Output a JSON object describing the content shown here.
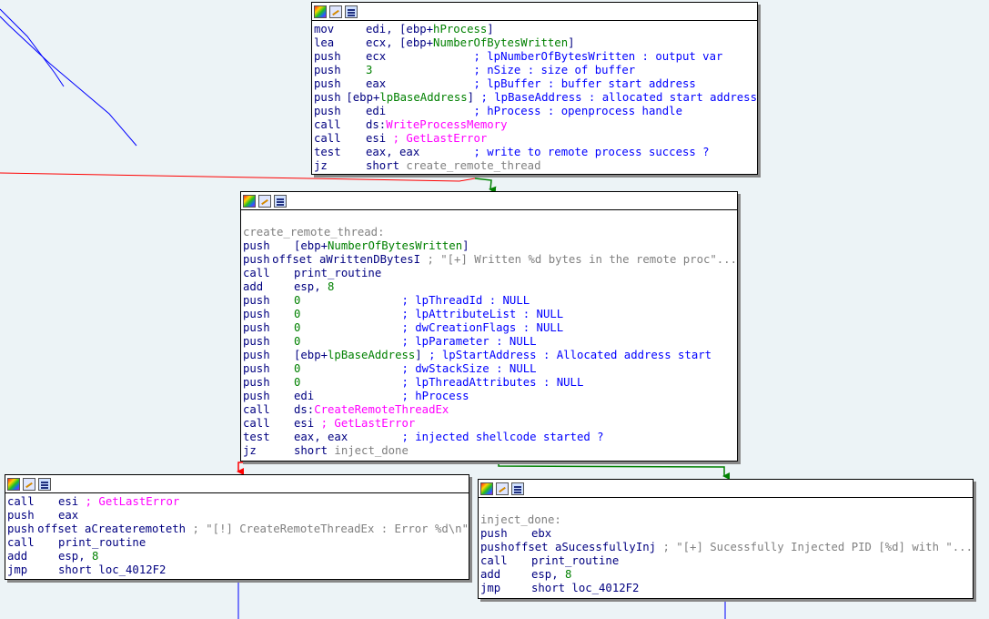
{
  "colors": {
    "background": "#ecf3f6",
    "false_branch_edge": "#ff0000",
    "true_branch_edge": "#008000",
    "normal_edge": "#0000ff",
    "mnemonic": "#000080",
    "immediate": "#008000",
    "import": "#ff00ff",
    "comment": "#0000ff",
    "string_comment": "#808080"
  },
  "icons": [
    "color-block-icon",
    "graph-overview-icon",
    "text-view-icon"
  ],
  "block1": {
    "lines": [
      {
        "m": "mov",
        "o": "edi, [ebp+",
        "v": "hProcess",
        "e": "]"
      },
      {
        "m": "lea",
        "o": "ecx, [ebp+",
        "v": "NumberOfBytesWritten",
        "e": "]"
      },
      {
        "m": "push",
        "o": "ecx             ",
        "c": "; lpNumberOfBytesWritten : output var"
      },
      {
        "m": "push",
        "n": "3",
        "o": "               ",
        "c": "; nSize : size of buffer"
      },
      {
        "m": "push",
        "o": "eax             ",
        "c": "; lpBuffer : buffer start address"
      },
      {
        "m": "push",
        "o": "[ebp+",
        "v": "lpBaseAddress",
        "e": "] ",
        "c": "; lpBaseAddress : allocated start address"
      },
      {
        "m": "push",
        "o": "edi             ",
        "c": "; hProcess : openprocess handle"
      },
      {
        "m": "call",
        "o": "ds:",
        "f": "WriteProcessMemory"
      },
      {
        "m": "call",
        "o": "esi ",
        "f": "; GetLastError"
      },
      {
        "m": "test",
        "o": "eax, eax        ",
        "c": "; write to remote process success ?"
      },
      {
        "m": "jz",
        "o": "short ",
        "l": "create_remote_thread"
      }
    ]
  },
  "block2": {
    "label": "create_remote_thread:",
    "lines": [
      {
        "m": "push",
        "o": "[ebp+",
        "v": "NumberOfBytesWritten",
        "e": "]"
      },
      {
        "m": "push",
        "o": "offset aWrittenDBytesI ",
        "s": "; \"[+] Written %d bytes in the remote proc\"..."
      },
      {
        "m": "call",
        "o": "print_routine"
      },
      {
        "m": "add",
        "o": "esp, ",
        "n": "8"
      },
      {
        "m": "push",
        "n": "0",
        "o": "               ",
        "c": "; lpThreadId : NULL"
      },
      {
        "m": "push",
        "n": "0",
        "o": "               ",
        "c": "; lpAttributeList : NULL"
      },
      {
        "m": "push",
        "n": "0",
        "o": "               ",
        "c": "; dwCreationFlags : NULL"
      },
      {
        "m": "push",
        "n": "0",
        "o": "               ",
        "c": "; lpParameter : NULL"
      },
      {
        "m": "push",
        "o": "[ebp+",
        "v": "lpBaseAddress",
        "e": "] ",
        "c": "; lpStartAddress : Allocated address start"
      },
      {
        "m": "push",
        "n": "0",
        "o": "               ",
        "c": "; dwStackSize : NULL"
      },
      {
        "m": "push",
        "n": "0",
        "o": "               ",
        "c": "; lpThreadAttributes : NULL"
      },
      {
        "m": "push",
        "o": "edi             ",
        "c": "; hProcess"
      },
      {
        "m": "call",
        "o": "ds:",
        "f": "CreateRemoteThreadEx"
      },
      {
        "m": "call",
        "o": "esi ",
        "f": "; GetLastError"
      },
      {
        "m": "test",
        "o": "eax, eax        ",
        "c": "; injected shellcode started ?"
      },
      {
        "m": "jz",
        "o": "short ",
        "l": "inject_done"
      }
    ]
  },
  "block3": {
    "lines": [
      {
        "m": "call",
        "o": "esi ",
        "f": "; GetLastError"
      },
      {
        "m": "push",
        "o": "eax"
      },
      {
        "m": "push",
        "o": "offset aCreateremoteth ",
        "s": "; \"[!] CreateRemoteThreadEx : Error %d\\n\""
      },
      {
        "m": "call",
        "o": "print_routine"
      },
      {
        "m": "add",
        "o": "esp, ",
        "n": "8"
      },
      {
        "m": "jmp",
        "o": "short loc_4012F2"
      }
    ]
  },
  "block4": {
    "label": "inject_done:",
    "lines": [
      {
        "m": "push",
        "o": "ebx"
      },
      {
        "m": "push",
        "o": "offset aSucessfullyInj ",
        "s": "; \"[+] Sucessfully Injected PID [%d] with \"..."
      },
      {
        "m": "call",
        "o": "print_routine"
      },
      {
        "m": "add",
        "o": "esp, ",
        "n": "8"
      },
      {
        "m": "jmp",
        "o": "short loc_4012F2"
      }
    ]
  }
}
